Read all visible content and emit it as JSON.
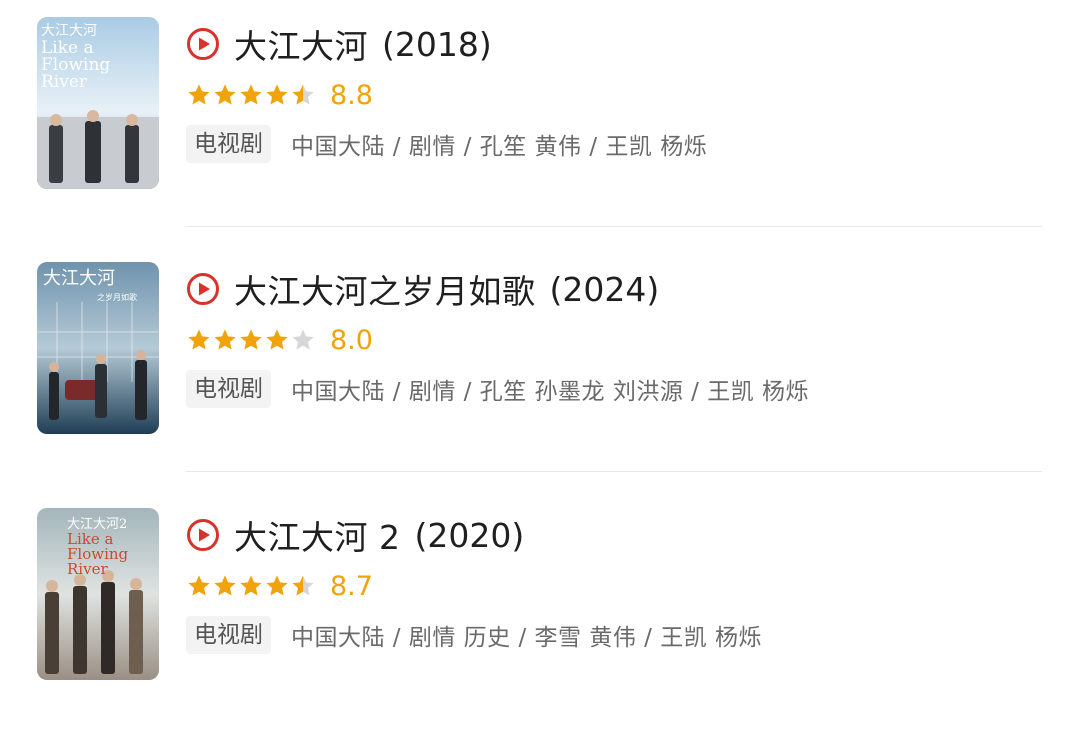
{
  "items": [
    {
      "title": "大江大河",
      "year": "(2018)",
      "rating": 4.5,
      "score": "8.8",
      "tag": "电视剧",
      "meta": "中国大陆 / 剧情 / 孔笙 黄伟 / 王凯 杨烁",
      "poster": {
        "text_lines": [
          "大江大河",
          "Like a",
          "Flowing",
          "River"
        ],
        "palette": [
          "#b9d6ea",
          "#eaf2f7",
          "#3b3f45"
        ]
      }
    },
    {
      "title": "大江大河之岁月如歌",
      "year": "(2024)",
      "rating": 4.0,
      "score": "8.0",
      "tag": "电视剧",
      "meta": "中国大陆 / 剧情 / 孔笙 孙墨龙 刘洪源 / 王凯 杨烁",
      "poster": {
        "text_lines": [
          "大江大河",
          "之岁月如歌"
        ],
        "palette": [
          "#1f4f6d",
          "#9fb8c8",
          "#2a2f36"
        ]
      }
    },
    {
      "title": "大江大河 2",
      "year": "(2020)",
      "rating": 4.5,
      "score": "8.7",
      "tag": "电视剧",
      "meta": "中国大陆 / 剧情 历史 / 李雪 黄伟 / 王凯 杨烁",
      "poster": {
        "text_lines": [
          "大江大河2",
          "Like a",
          "Flowing",
          "River"
        ],
        "palette": [
          "#b8c4c7",
          "#e6e8e6",
          "#3a3430"
        ]
      }
    }
  ],
  "colors": {
    "accent_red": "#d8322a",
    "star_gold": "#f0a30a",
    "star_gray": "#d7d7d7"
  }
}
